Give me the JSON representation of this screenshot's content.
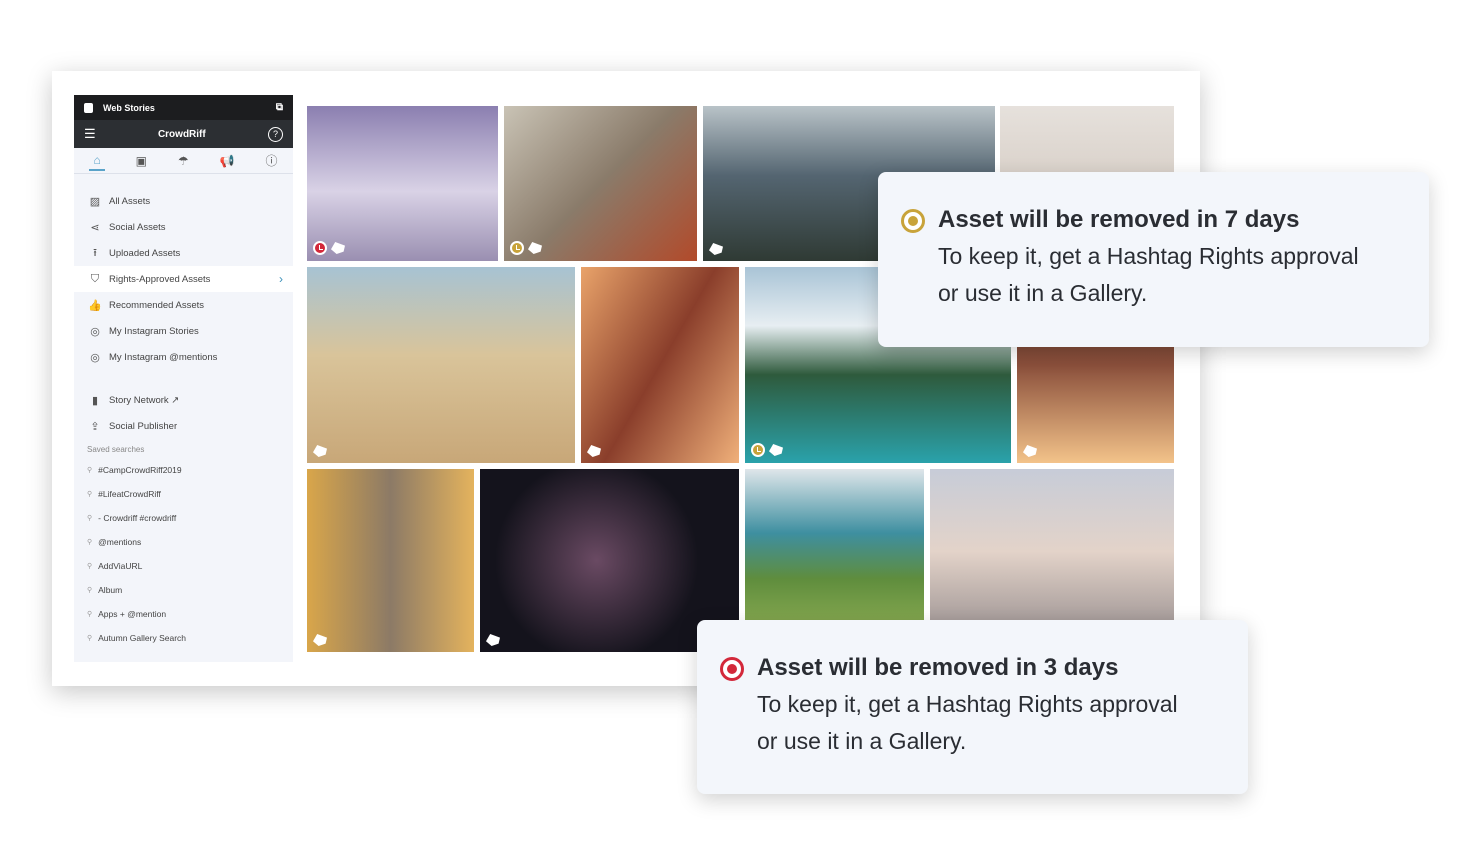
{
  "sidebar": {
    "top_title": "Web Stories",
    "brand": "CrowdRiff",
    "help": "?",
    "tabs": [
      "home",
      "media",
      "social",
      "megaphone",
      "info"
    ],
    "items": [
      {
        "label": "All Assets",
        "icon": "image-icon"
      },
      {
        "label": "Social Assets",
        "icon": "share-icon"
      },
      {
        "label": "Uploaded Assets",
        "icon": "upload-icon"
      },
      {
        "label": "Rights-Approved Assets",
        "icon": "shield-icon"
      },
      {
        "label": "Recommended Assets",
        "icon": "thumbs-up-icon"
      },
      {
        "label": "My Instagram Stories",
        "icon": "instagram-icon"
      },
      {
        "label": "My Instagram @mentions",
        "icon": "instagram-icon"
      }
    ],
    "tools": [
      {
        "label": "Story Network ↗",
        "icon": "story-icon"
      },
      {
        "label": "Social Publisher",
        "icon": "publish-icon"
      }
    ],
    "saved_header": "Saved searches",
    "saved": [
      "#CampCrowdRiff2019",
      "#LifeatCrowdRiff",
      "- Crowdriff #crowdriff",
      "@mentions",
      "AddViaURL",
      "Album",
      "Apps + @mention",
      "Autumn Gallery Search"
    ]
  },
  "toasts": [
    {
      "title": "Asset will be removed in 7 days",
      "line1": "To keep it, get a Hashtag Rights approval",
      "line2": "or use it in a Gallery.",
      "color": "#c8a33a"
    },
    {
      "title": "Asset will be removed in 3 days",
      "line1": "To keep it, get a Hashtag Rights approval",
      "line2": "or use it in a Gallery.",
      "color": "#d3283a"
    }
  ],
  "colors": {
    "warning": "#c8a33a",
    "danger": "#d3283a",
    "accent": "#5aa3c9"
  }
}
